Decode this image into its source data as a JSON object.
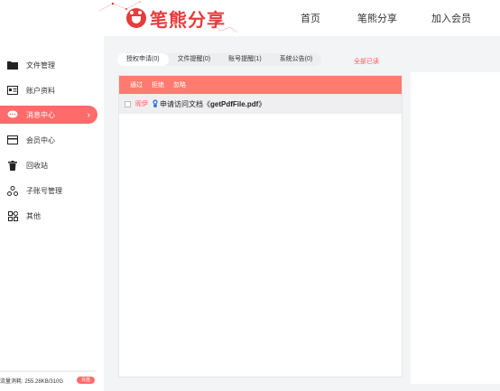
{
  "header": {
    "logo_text": "笔熊分享",
    "nav": {
      "home": "首页",
      "share": "笔熊分享",
      "join": "加入会员"
    }
  },
  "sidebar": {
    "items": [
      {
        "label": "文件管理",
        "icon": "folder-icon"
      },
      {
        "label": "账户资料",
        "icon": "id-card-icon"
      },
      {
        "label": "消息中心",
        "icon": "message-icon"
      },
      {
        "label": "会员中心",
        "icon": "card-icon"
      },
      {
        "label": "回收站",
        "icon": "trash-icon"
      },
      {
        "label": "子账号管理",
        "icon": "sub-account-icon"
      },
      {
        "label": "其他",
        "icon": "grid-icon"
      }
    ],
    "usage_label": "流量消耗: 255.28KB/310G",
    "usage_button": "充值",
    "accent_color": "#ff6b6b"
  },
  "main": {
    "tabs": [
      {
        "label": "授权申请(0)"
      },
      {
        "label": "文件提醒(0)"
      },
      {
        "label": "账号提醒(1)"
      },
      {
        "label": "系统公告(0)"
      }
    ],
    "mark_all_read": "全部已读",
    "actions": {
      "approve": "通过",
      "reject": "拒绝",
      "ignore": "忽略"
    },
    "rows": [
      {
        "name": "昵伊",
        "text_prefix": "申请访问文档《",
        "file": "getPdfFile.pdf",
        "text_suffix": "》"
      }
    ]
  }
}
